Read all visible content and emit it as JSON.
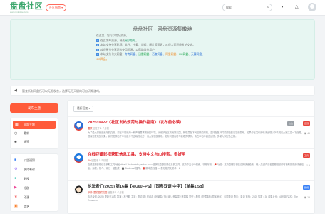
{
  "header": {
    "logo_text": "盘盘社区",
    "logo_sub": "www.ilinkplate.com",
    "nav_label": "社区指南 ▾",
    "search_placeholder": "搜索",
    "icons": [
      "search-icon",
      "moon-icon",
      "bell-icon",
      "avatar"
    ]
  },
  "hero": {
    "title": "盘盘社区 - 网盘资源集散地",
    "intro": "在这里，您可以用好资源。",
    "lines": [
      {
        "n": "1",
        "pre": "在此发布资源，请先",
        "hl": "阅读版规",
        "post": "。"
      },
      {
        "n": "2",
        "pre": "本站支持分享影视、软件、书籍、课程、图片等资源，欢迎大家积极发帖交流。",
        "hl": "",
        "post": ""
      },
      {
        "n": "3",
        "pre": "欢迎更多分享您的使用资源，以帮助其他用户",
        "hl": "",
        "post": ""
      },
      {
        "n": "4",
        "pre": "本站支持七大网盘：",
        "hl": "",
        "post": ""
      }
    ],
    "disks": [
      "夸克网盘、",
      "迅雷网盘、",
      "百度网盘、",
      "阿里网盘、",
      "UC网盘、",
      "天翼网盘、"
    ],
    "disk_last": "115网盘。"
  },
  "notice": {
    "icon": "megaphone-icon",
    "text": "暂查所有网盘所可以无限发言，选择无尽天赋的可自研频道吗。"
  },
  "sidebar": {
    "post_button": "发布主题",
    "items": [
      {
        "label": "全部主题",
        "icon": "grid-icon",
        "active": true
      },
      {
        "label": "最新",
        "icon": "clock-icon",
        "active": false
      },
      {
        "label": "标签",
        "icon": "tag-icon",
        "active": false
      }
    ],
    "categories": [
      {
        "label": "公告通知",
        "icon": "bell-icon",
        "color": "blue"
      },
      {
        "label": "求片有帮",
        "icon": "gear-icon",
        "color": "purple"
      },
      {
        "label": "影视",
        "icon": "film-icon",
        "color": "teal"
      },
      {
        "label": "短剧",
        "icon": "play-icon",
        "color": "pink"
      },
      {
        "label": "动漫",
        "icon": "star-icon",
        "color": "red"
      },
      {
        "label": "综艺",
        "icon": "tv-icon",
        "color": "orange"
      }
    ]
  },
  "main": {
    "sort_label": "最新回复 ▾",
    "posts": [
      {
        "title": "2025/04/22《社区发帖规范与操作指南》（发布前必读）",
        "title_color": "red",
        "author": "管家",
        "meta": "回复于 1 个月前",
        "body": "为了给大家营造良好的交流，现在不再采用一种严格要求提升的环境。为维护社区的良好氛围，管理员在下列这样的规则，坚持在各种共同规范的内容的发布，如果你在发布的帖子出现以下情况请大家注意一下处理，提高您发帖的效果，我们发现帖子中有部分不正确的地方，请大家积极发现，如有问题及时与管理员联系，请在本帖中留言反馈，多谢大家配合支持。",
        "tags": [
          "公告",
          "置顶"
        ],
        "stat_icon": "eye-icon",
        "stat": "46"
      },
      {
        "title": "在线豆瓣影视获取信息工具，支持中文与ID搜索，很好用",
        "title_color": "red",
        "author": "Phi",
        "meta": "回复于 1 个月前",
        "body": "在线豆瓣影视信息获取工具 地址https:// doubaninfo.pankas.cc  一键获取豆瓣影视信息的工具，支持中文与ID搜索，非常好用。📌 功能：支持豆瓣影视信息的快速检索，输入关键词或者豆瓣链接即可获取影视的详细信息，海报、简介、评分一键生成，🎬 Bookmark插件，📕 脚本查找器 — 发帖格式化助手，Z",
        "tags": [
          "工具"
        ],
        "stat_icon": "comment-icon",
        "stat": "6"
      },
      {
        "title": "执法者们(2025) 第16集【4K/60FPS】【国粤双语 中字】【单集1.5g】",
        "title_color": "dark",
        "author": "伊祥4里的豆腐花园",
        "meta": "回复于 1 个月前",
        "body": "执法者们 (2025) 更新至16集 导演：林子聪 主演：郑嘉颖 / 吴卓羲 / 张曦雯 / 陈山聪 / 黄智雯 / 陈展鹏 类型：剧情 / 犯罪 制片国家/地区：中国香港 语言：粤语 首播：2025 集数：30 单集片长：45分钟 又名：The Enforcers",
        "tags": [
          "影视"
        ],
        "stat_icon": "eye-icon",
        "stat": "19"
      }
    ]
  }
}
